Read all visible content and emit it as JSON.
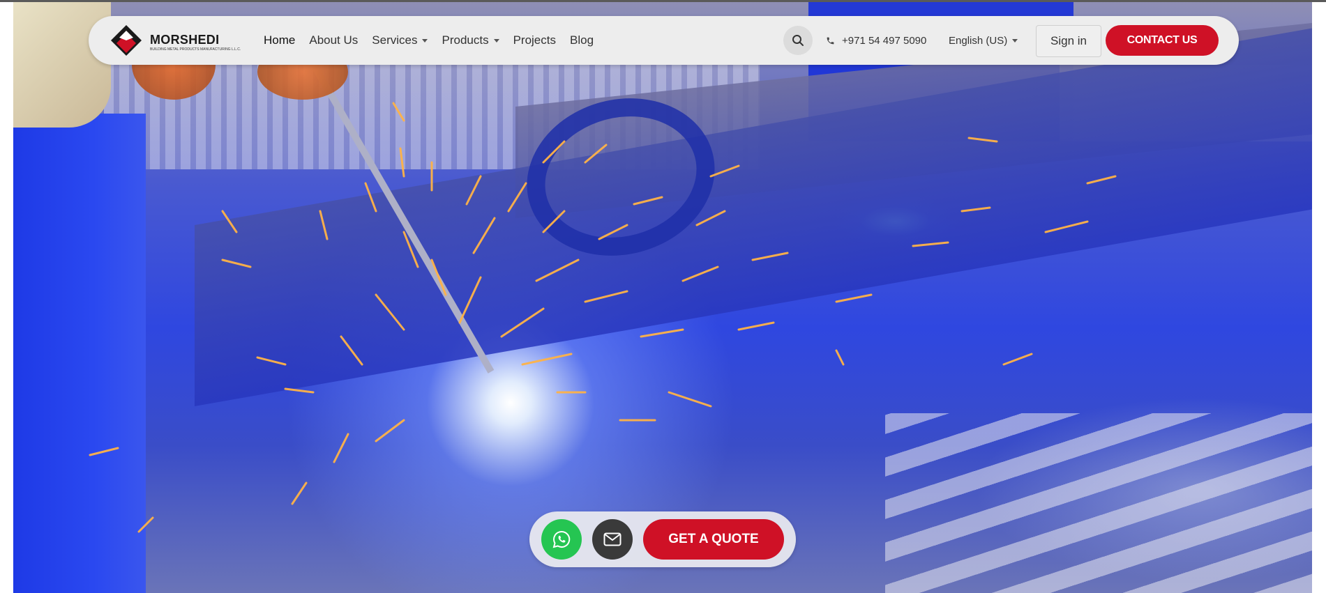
{
  "brand": {
    "name": "MORSHEDI",
    "tagline": "BUILDING METAL PRODUCTS MANUFACTURING L.L.C.",
    "colors": {
      "red": "#cf1126",
      "dark": "#1a1a1a"
    }
  },
  "nav": {
    "items": [
      {
        "label": "Home",
        "dropdown": false,
        "active": true
      },
      {
        "label": "About Us",
        "dropdown": false
      },
      {
        "label": "Services",
        "dropdown": true
      },
      {
        "label": "Products",
        "dropdown": true
      },
      {
        "label": "Projects",
        "dropdown": false
      },
      {
        "label": "Blog",
        "dropdown": false
      }
    ]
  },
  "header": {
    "search_icon": "search-icon",
    "phone": "+971 54 497 5090",
    "language": "English (US)",
    "signin_label": "Sign in",
    "contact_label": "CONTACT US"
  },
  "cta": {
    "whatsapp_icon": "whatsapp-icon",
    "mail_icon": "mail-icon",
    "quote_label": "GET A QUOTE",
    "whatsapp_color": "#25c552",
    "mail_color": "#3a3a3a"
  },
  "hero": {
    "image": "welding-sparks-background"
  }
}
